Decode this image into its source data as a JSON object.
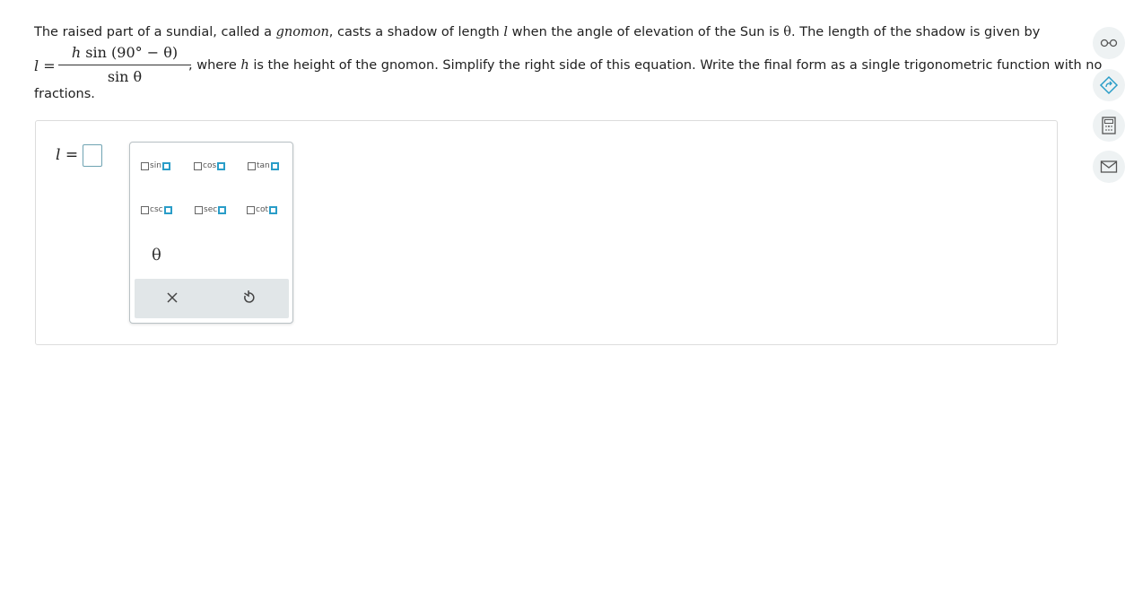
{
  "question": {
    "line1": {
      "a": "The raised part of a sundial, called a ",
      "gnomon": "gnomon",
      "b": ", casts a shadow of length ",
      "l": "l",
      "c": " when the angle of elevation of the Sun is ",
      "theta": "θ",
      "d": ". The length of the shadow is given by"
    },
    "equation": {
      "lhs_var": "l",
      "lhs_eq": " =",
      "num_h": "h",
      "num_rest": " sin (90° − θ)",
      "den": "sin θ",
      "tail_a": ", where ",
      "tail_h": "h",
      "tail_b": " is the height of the gnomon. Simplify the right side of this equation. Write the final form as a single trigonometric function with no"
    },
    "line3": "fractions."
  },
  "answer": {
    "label_var": "l",
    "label_eq": " ="
  },
  "palette": {
    "row1": [
      "sin",
      "cos",
      "tan"
    ],
    "row2": [
      "csc",
      "sec",
      "cot"
    ],
    "theta": "θ",
    "clear_icon": "close-icon",
    "undo_icon": "undo-icon"
  },
  "sidebar": {
    "icons": [
      "glasses-icon",
      "hint-icon",
      "calculator-icon",
      "mail-icon"
    ]
  },
  "colors": {
    "accent": "#2a9dc8",
    "footer_bg": "#e1e6e8",
    "side_btn_bg": "#eef2f3"
  }
}
